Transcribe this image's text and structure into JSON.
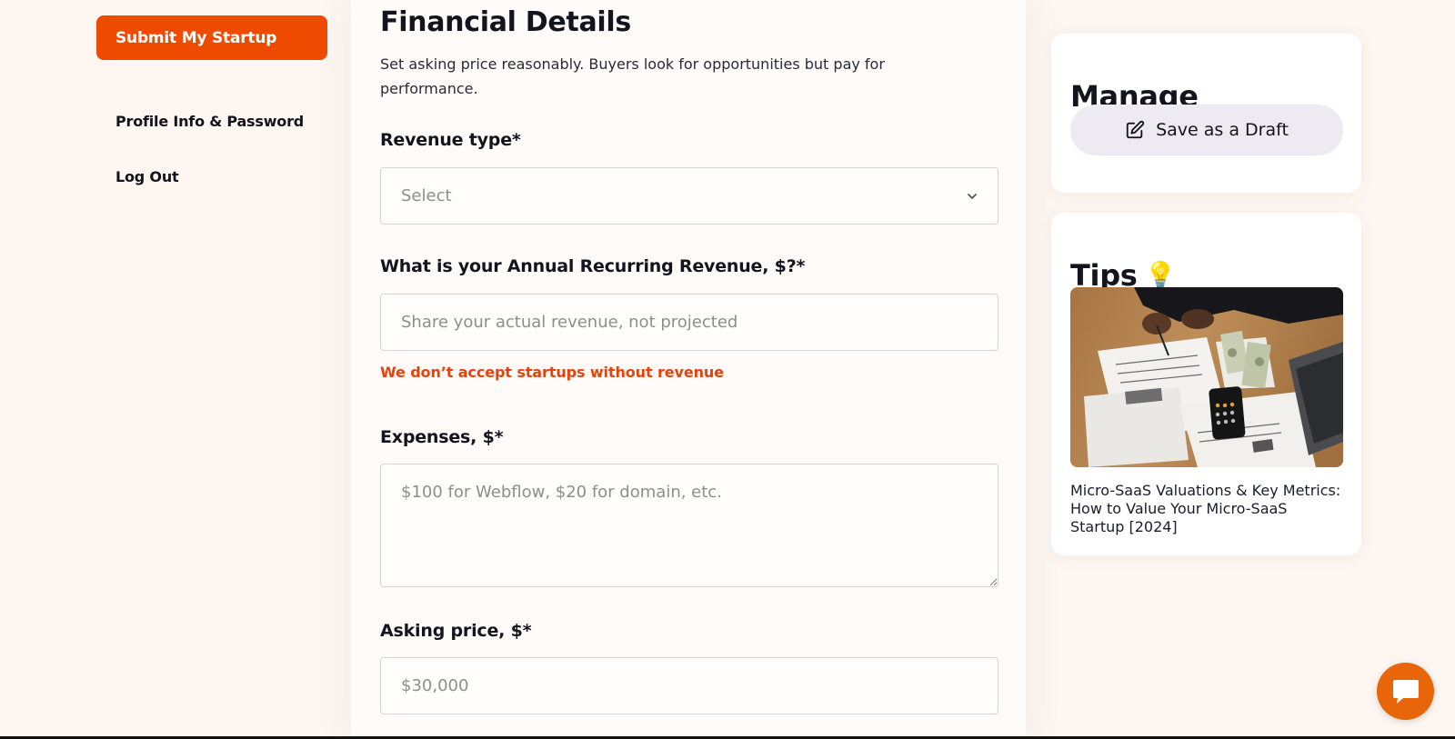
{
  "sidebar": {
    "submit_label": "Submit My Startup",
    "items": [
      {
        "label": "Profile Info & Password"
      },
      {
        "label": "Log Out"
      }
    ]
  },
  "form": {
    "title": "Financial Details",
    "subtitle": "Set asking price reasonably. Buyers look for opportunities but pay for performance.",
    "revenue_type": {
      "label": "Revenue type*",
      "selected": "Select"
    },
    "arr": {
      "label": "What is your Annual Recurring Revenue, $?*",
      "placeholder": "Share your actual revenue, not projected",
      "error": "We don’t accept startups without revenue"
    },
    "expenses": {
      "label": "Expenses, $*",
      "placeholder": "$100 for Webflow, $20 for domain, etc."
    },
    "asking_price": {
      "label": "Asking price, $*",
      "placeholder": "$30,000"
    }
  },
  "manage": {
    "title": "Manage",
    "draft_label": "Save as a Draft"
  },
  "tips": {
    "title": "Tips",
    "emoji": "💡",
    "article": "Micro-SaaS Valuations & Key Metrics: How to Value Your Micro-SaaS Startup [2024]"
  },
  "colors": {
    "accent": "#ef4b00",
    "error": "#e5430a",
    "chat": "#e8650a"
  }
}
